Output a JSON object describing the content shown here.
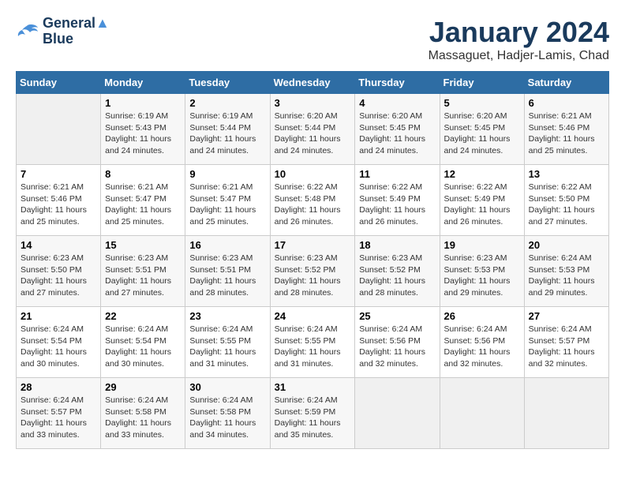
{
  "logo": {
    "line1": "General",
    "line2": "Blue"
  },
  "title": "January 2024",
  "location": "Massaguet, Hadjer-Lamis, Chad",
  "days_of_week": [
    "Sunday",
    "Monday",
    "Tuesday",
    "Wednesday",
    "Thursday",
    "Friday",
    "Saturday"
  ],
  "weeks": [
    [
      {
        "day": "",
        "info": ""
      },
      {
        "day": "1",
        "info": "Sunrise: 6:19 AM\nSunset: 5:43 PM\nDaylight: 11 hours\nand 24 minutes."
      },
      {
        "day": "2",
        "info": "Sunrise: 6:19 AM\nSunset: 5:44 PM\nDaylight: 11 hours\nand 24 minutes."
      },
      {
        "day": "3",
        "info": "Sunrise: 6:20 AM\nSunset: 5:44 PM\nDaylight: 11 hours\nand 24 minutes."
      },
      {
        "day": "4",
        "info": "Sunrise: 6:20 AM\nSunset: 5:45 PM\nDaylight: 11 hours\nand 24 minutes."
      },
      {
        "day": "5",
        "info": "Sunrise: 6:20 AM\nSunset: 5:45 PM\nDaylight: 11 hours\nand 24 minutes."
      },
      {
        "day": "6",
        "info": "Sunrise: 6:21 AM\nSunset: 5:46 PM\nDaylight: 11 hours\nand 25 minutes."
      }
    ],
    [
      {
        "day": "7",
        "info": "Sunrise: 6:21 AM\nSunset: 5:46 PM\nDaylight: 11 hours\nand 25 minutes."
      },
      {
        "day": "8",
        "info": "Sunrise: 6:21 AM\nSunset: 5:47 PM\nDaylight: 11 hours\nand 25 minutes."
      },
      {
        "day": "9",
        "info": "Sunrise: 6:21 AM\nSunset: 5:47 PM\nDaylight: 11 hours\nand 25 minutes."
      },
      {
        "day": "10",
        "info": "Sunrise: 6:22 AM\nSunset: 5:48 PM\nDaylight: 11 hours\nand 26 minutes."
      },
      {
        "day": "11",
        "info": "Sunrise: 6:22 AM\nSunset: 5:49 PM\nDaylight: 11 hours\nand 26 minutes."
      },
      {
        "day": "12",
        "info": "Sunrise: 6:22 AM\nSunset: 5:49 PM\nDaylight: 11 hours\nand 26 minutes."
      },
      {
        "day": "13",
        "info": "Sunrise: 6:22 AM\nSunset: 5:50 PM\nDaylight: 11 hours\nand 27 minutes."
      }
    ],
    [
      {
        "day": "14",
        "info": "Sunrise: 6:23 AM\nSunset: 5:50 PM\nDaylight: 11 hours\nand 27 minutes."
      },
      {
        "day": "15",
        "info": "Sunrise: 6:23 AM\nSunset: 5:51 PM\nDaylight: 11 hours\nand 27 minutes."
      },
      {
        "day": "16",
        "info": "Sunrise: 6:23 AM\nSunset: 5:51 PM\nDaylight: 11 hours\nand 28 minutes."
      },
      {
        "day": "17",
        "info": "Sunrise: 6:23 AM\nSunset: 5:52 PM\nDaylight: 11 hours\nand 28 minutes."
      },
      {
        "day": "18",
        "info": "Sunrise: 6:23 AM\nSunset: 5:52 PM\nDaylight: 11 hours\nand 28 minutes."
      },
      {
        "day": "19",
        "info": "Sunrise: 6:23 AM\nSunset: 5:53 PM\nDaylight: 11 hours\nand 29 minutes."
      },
      {
        "day": "20",
        "info": "Sunrise: 6:24 AM\nSunset: 5:53 PM\nDaylight: 11 hours\nand 29 minutes."
      }
    ],
    [
      {
        "day": "21",
        "info": "Sunrise: 6:24 AM\nSunset: 5:54 PM\nDaylight: 11 hours\nand 30 minutes."
      },
      {
        "day": "22",
        "info": "Sunrise: 6:24 AM\nSunset: 5:54 PM\nDaylight: 11 hours\nand 30 minutes."
      },
      {
        "day": "23",
        "info": "Sunrise: 6:24 AM\nSunset: 5:55 PM\nDaylight: 11 hours\nand 31 minutes."
      },
      {
        "day": "24",
        "info": "Sunrise: 6:24 AM\nSunset: 5:55 PM\nDaylight: 11 hours\nand 31 minutes."
      },
      {
        "day": "25",
        "info": "Sunrise: 6:24 AM\nSunset: 5:56 PM\nDaylight: 11 hours\nand 32 minutes."
      },
      {
        "day": "26",
        "info": "Sunrise: 6:24 AM\nSunset: 5:56 PM\nDaylight: 11 hours\nand 32 minutes."
      },
      {
        "day": "27",
        "info": "Sunrise: 6:24 AM\nSunset: 5:57 PM\nDaylight: 11 hours\nand 32 minutes."
      }
    ],
    [
      {
        "day": "28",
        "info": "Sunrise: 6:24 AM\nSunset: 5:57 PM\nDaylight: 11 hours\nand 33 minutes."
      },
      {
        "day": "29",
        "info": "Sunrise: 6:24 AM\nSunset: 5:58 PM\nDaylight: 11 hours\nand 33 minutes."
      },
      {
        "day": "30",
        "info": "Sunrise: 6:24 AM\nSunset: 5:58 PM\nDaylight: 11 hours\nand 34 minutes."
      },
      {
        "day": "31",
        "info": "Sunrise: 6:24 AM\nSunset: 5:59 PM\nDaylight: 11 hours\nand 35 minutes."
      },
      {
        "day": "",
        "info": ""
      },
      {
        "day": "",
        "info": ""
      },
      {
        "day": "",
        "info": ""
      }
    ]
  ]
}
